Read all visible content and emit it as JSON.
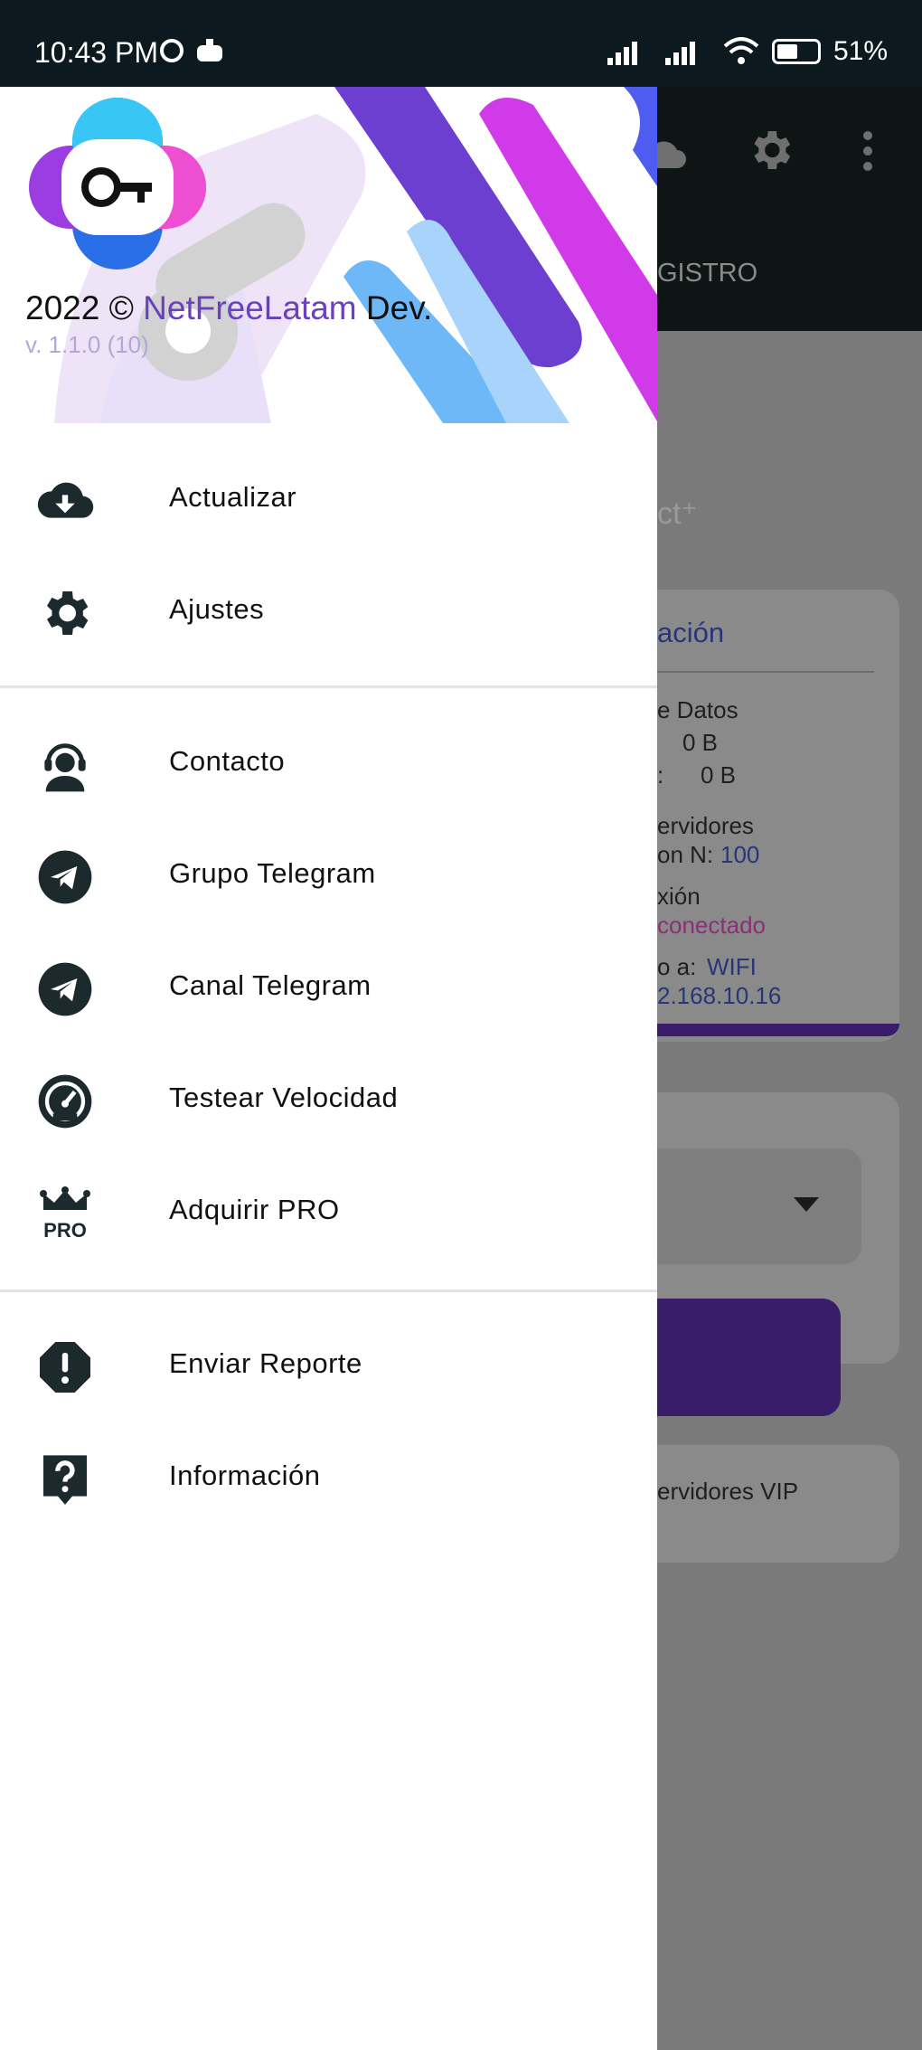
{
  "status_bar": {
    "time": "10:43 PM",
    "battery": "51%"
  },
  "background_app": {
    "tab_label": "GISTRO",
    "card_title": "ación",
    "rows": [
      "e Datos",
      "0 B",
      ":",
      "0 B",
      "ervidores",
      "on N:",
      "100",
      "xión",
      "conectado",
      "o a:",
      "WIFI",
      "2.168.10.16",
      "ervidores VIP"
    ]
  },
  "drawer": {
    "header": {
      "copyright_prefix": "2022 ©",
      "brand": "NetFreeLatam",
      "copyright_suffix": "Dev.",
      "version": "v. 1.1.0 (10)"
    },
    "section1": [
      {
        "label": "Actualizar",
        "icon": "cloud-download-icon"
      },
      {
        "label": "Ajustes",
        "icon": "gear-icon"
      }
    ],
    "section2": [
      {
        "label": "Contacto",
        "icon": "support-agent-icon"
      },
      {
        "label": "Grupo Telegram",
        "icon": "telegram-icon"
      },
      {
        "label": "Canal Telegram",
        "icon": "telegram-icon"
      },
      {
        "label": "Testear Velocidad",
        "icon": "speedometer-icon"
      },
      {
        "label": "Adquirir PRO",
        "icon": "crown-pro-icon"
      }
    ],
    "section3": [
      {
        "label": "Enviar Reporte",
        "icon": "report-icon"
      },
      {
        "label": "Información",
        "icon": "help-icon"
      }
    ],
    "pro_badge": "PRO"
  },
  "colors": {
    "brand_purple": "#6a3fc0",
    "drawer_bg": "#ffffff",
    "scrim": "#7a7a7a"
  }
}
